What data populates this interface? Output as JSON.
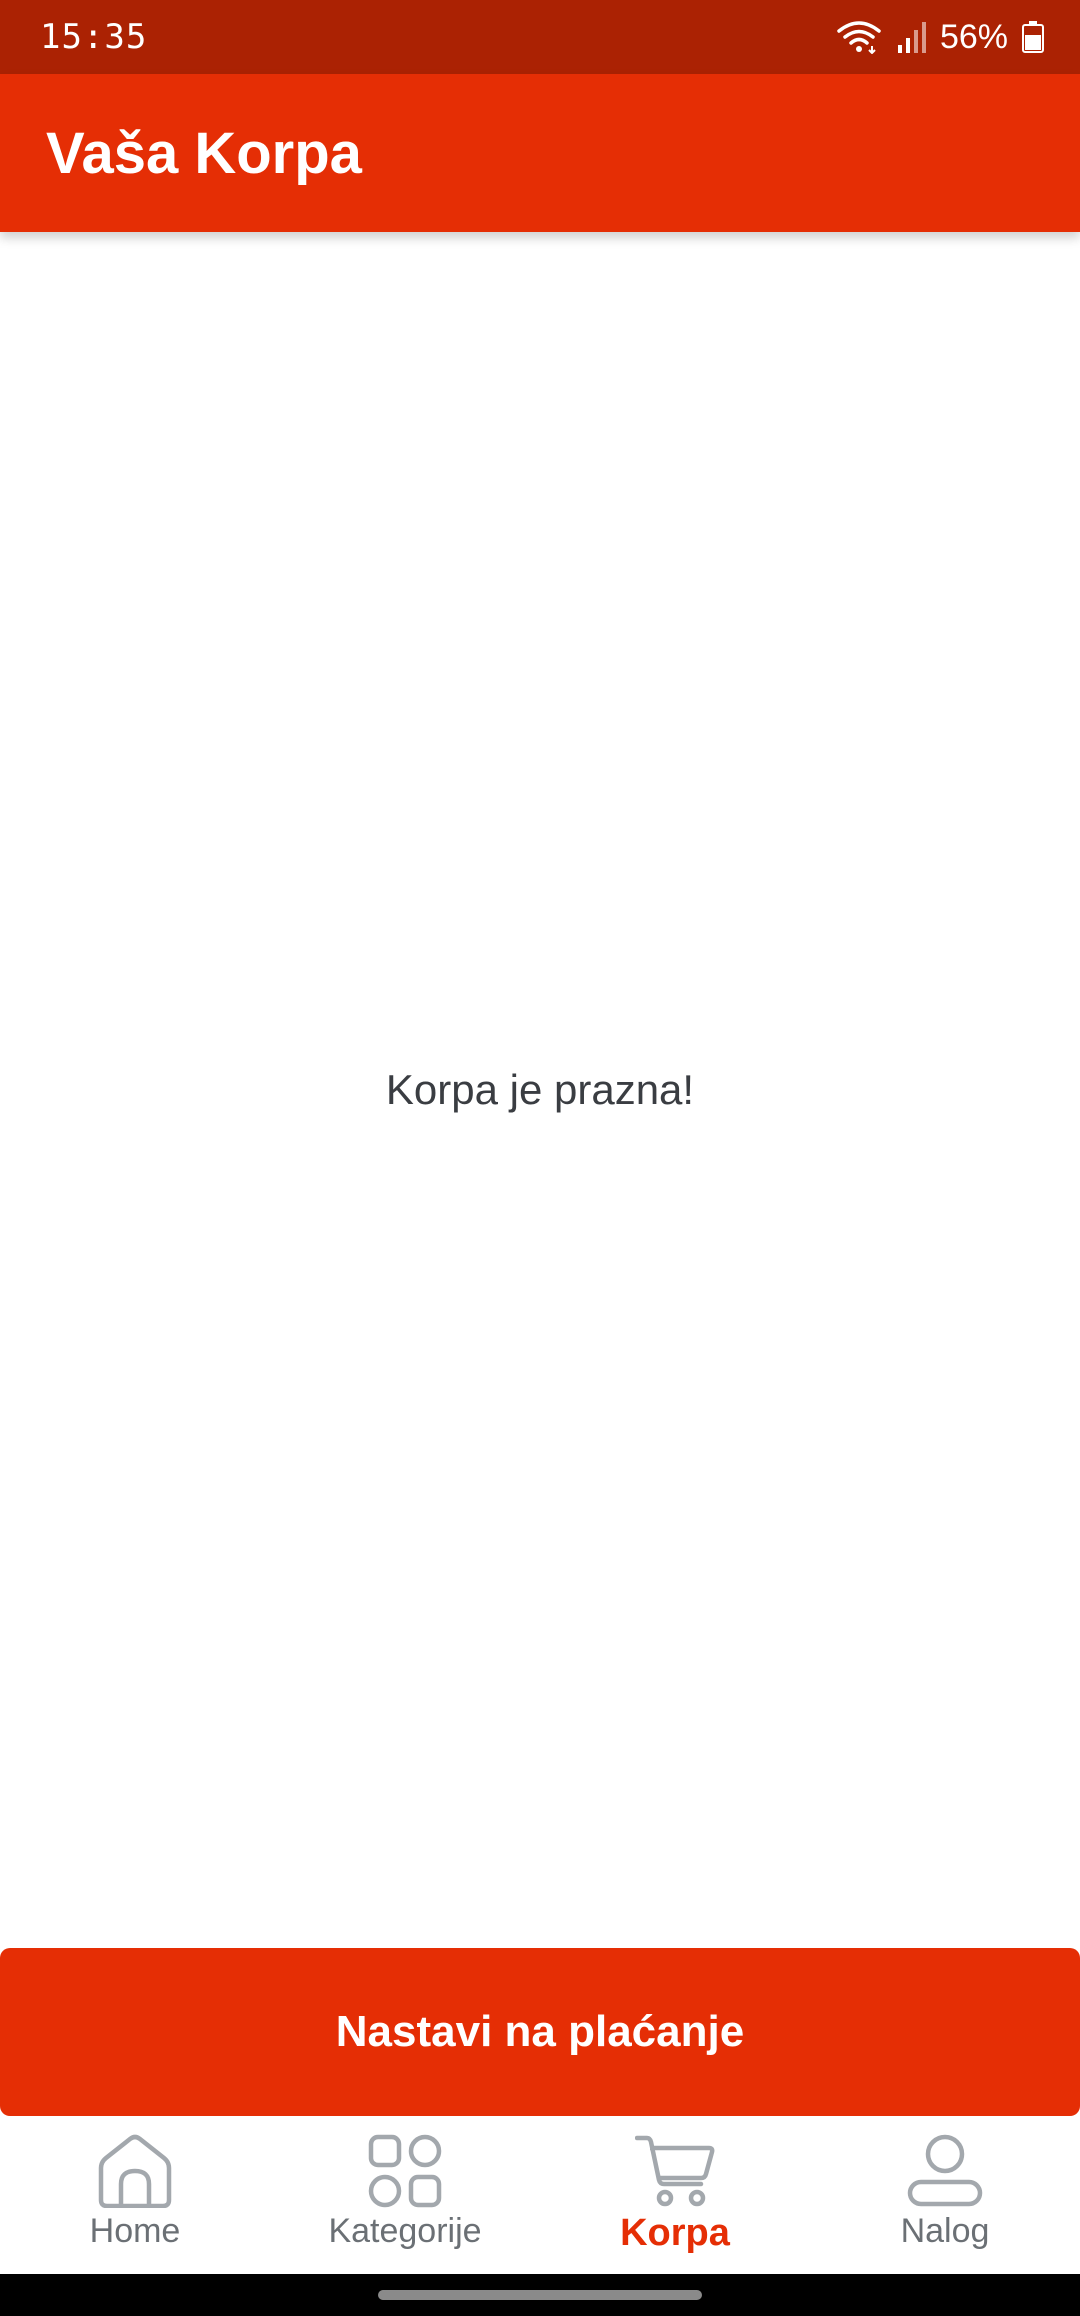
{
  "status_bar": {
    "time": "15:35",
    "battery": "56%",
    "icons": [
      "wifi-icon",
      "signal-icon",
      "battery-icon"
    ]
  },
  "app_bar": {
    "title": "Vaša Korpa"
  },
  "cart": {
    "empty_message": "Korpa je prazna!"
  },
  "checkout": {
    "label": "Nastavi na plaćanje"
  },
  "bottom_nav": {
    "items": [
      {
        "label": "Home",
        "icon": "home-icon",
        "active": false
      },
      {
        "label": "Kategorije",
        "icon": "categories-icon",
        "active": false
      },
      {
        "label": "Korpa",
        "icon": "cart-icon",
        "active": true
      },
      {
        "label": "Nalog",
        "icon": "account-icon",
        "active": false
      }
    ]
  },
  "colors": {
    "status_bar": "#ab2203",
    "accent": "#e52e05",
    "inactive": "#a3a8ad",
    "text": "#3a3d42"
  }
}
